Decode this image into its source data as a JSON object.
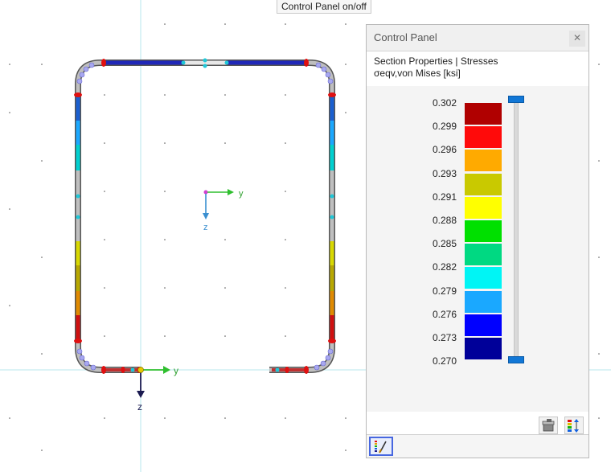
{
  "tooltip": "Control Panel on/off",
  "panel": {
    "title": "Control Panel",
    "close_glyph": "✕",
    "subtitle": "Section Properties | Stresses",
    "quantity": "σeqv,von Mises [ksi]"
  },
  "legend": {
    "values": [
      "0.302",
      "0.299",
      "0.296",
      "0.293",
      "0.291",
      "0.288",
      "0.285",
      "0.282",
      "0.279",
      "0.276",
      "0.273",
      "0.270"
    ],
    "colors": [
      "#b00000",
      "#ff0a0a",
      "#ffaa00",
      "#c9c900",
      "#ffff00",
      "#00e000",
      "#00d982",
      "#00f5f5",
      "#1aa8ff",
      "#0000ff",
      "#000099"
    ]
  },
  "axes": {
    "center": {
      "y": "y",
      "z": "z"
    },
    "origin": {
      "y": "y",
      "z": "z"
    }
  },
  "icons": {
    "settings": "paint-settings-icon",
    "scale": "color-scale-icon",
    "toggle": "color-legend-icon"
  }
}
